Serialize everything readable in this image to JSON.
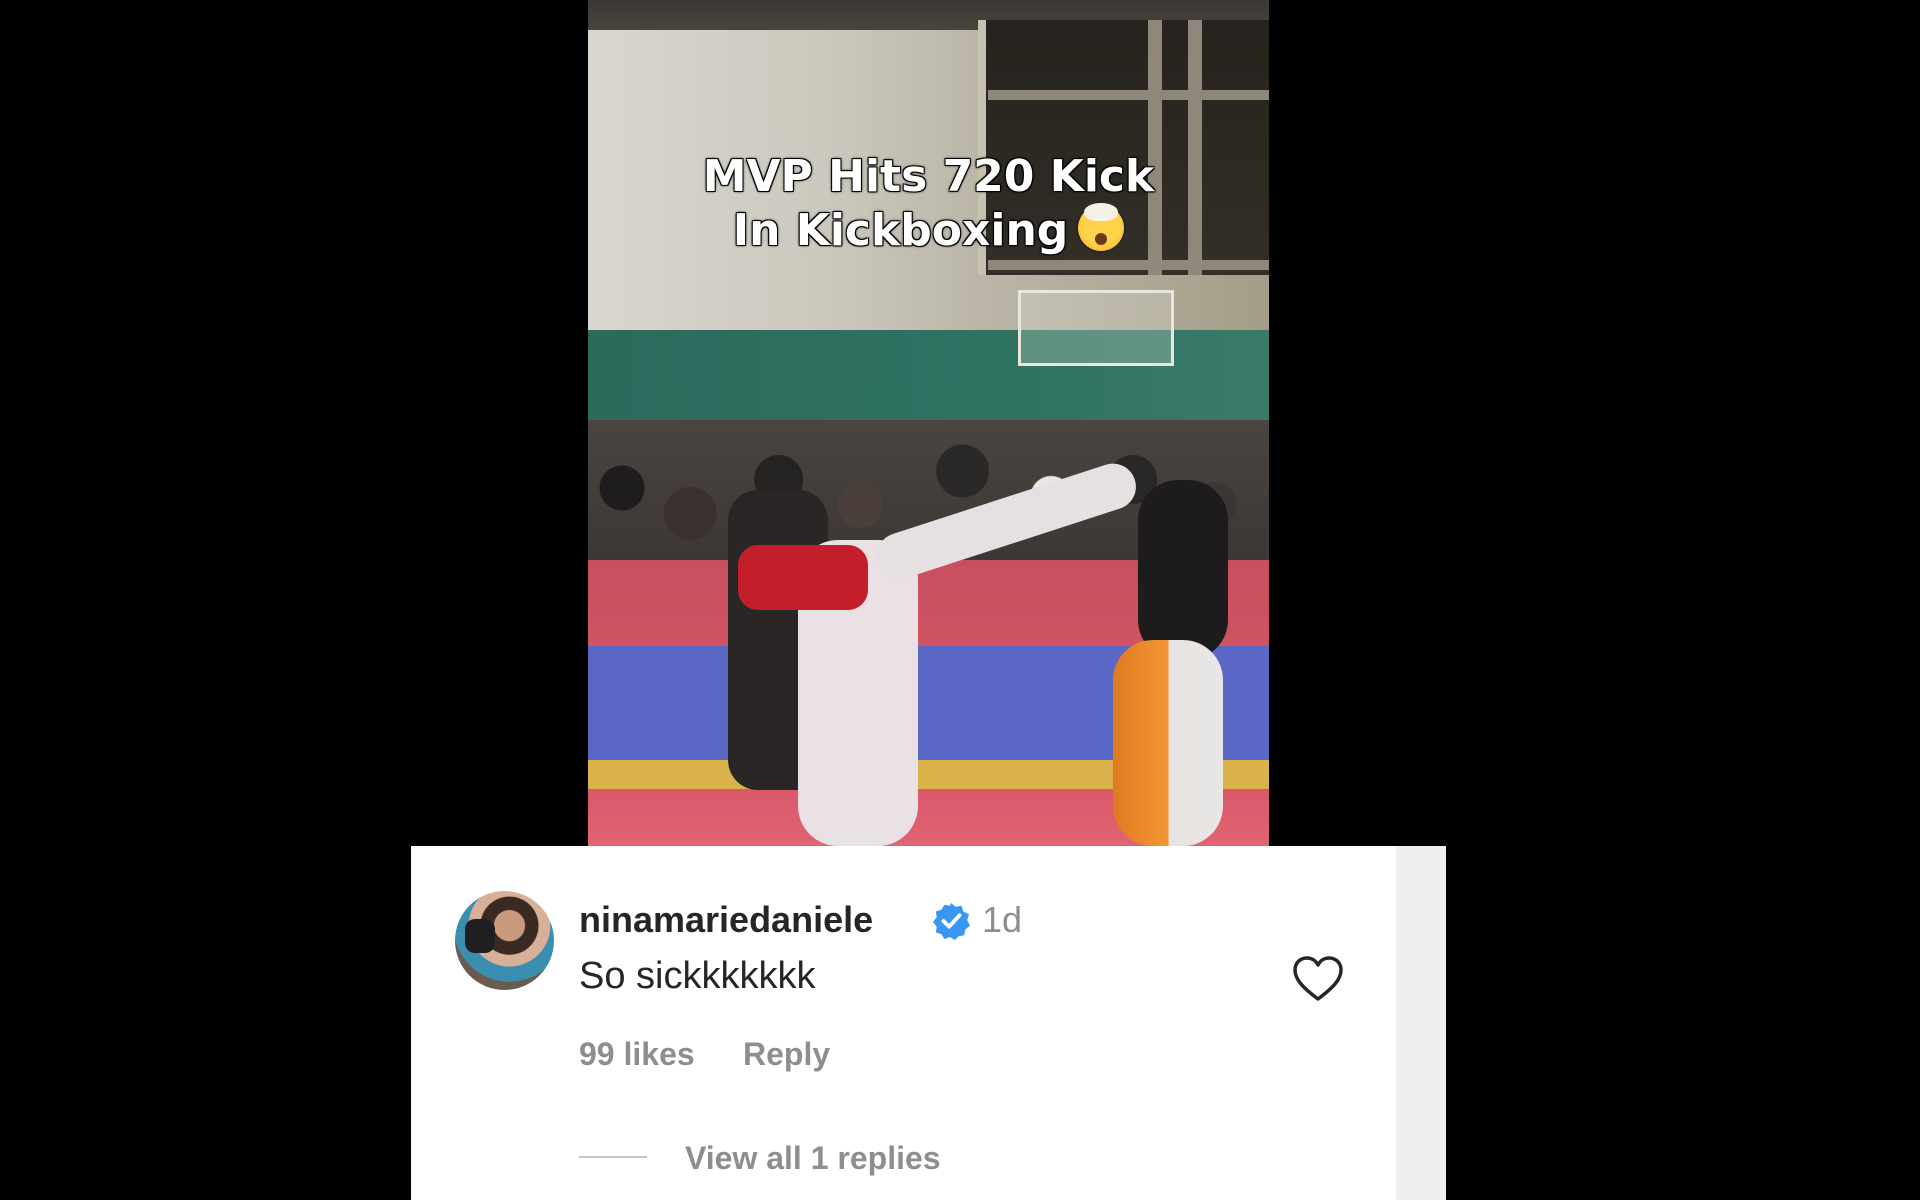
{
  "video": {
    "caption_line1": "MVP Hits 720 Kick",
    "caption_line2": "In Kickboxing",
    "caption_emoji": "exploding-head-emoji"
  },
  "comment": {
    "username": "ninamariedaniele",
    "verified": true,
    "timestamp": "1d",
    "text": "So sickkkkkkk",
    "likes": "99 likes",
    "reply_label": "Reply",
    "view_replies_label": "View all 1 replies",
    "liked": false
  },
  "colors": {
    "verified_badge": "#3897f0",
    "secondary_text": "#8e8e8e",
    "primary_text": "#262626"
  }
}
